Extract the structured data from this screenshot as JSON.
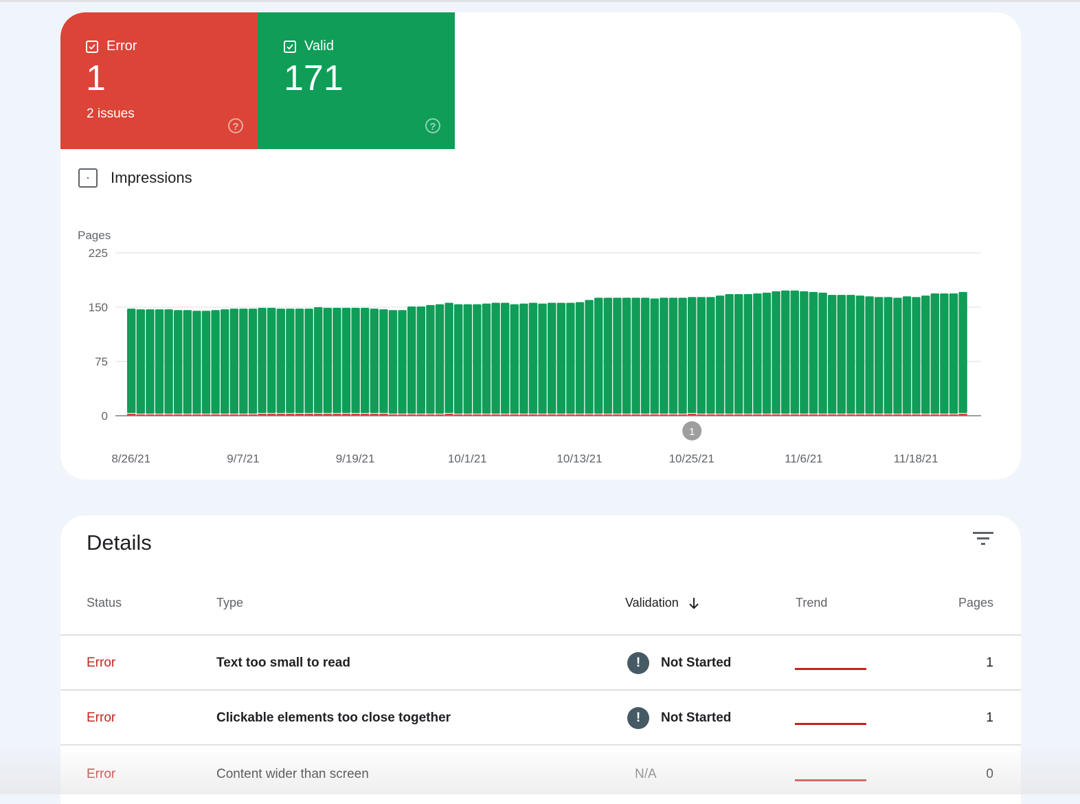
{
  "summary": {
    "error": {
      "label": "Error",
      "count": "1",
      "sub": "2 issues",
      "checked": true,
      "color": "#db4437"
    },
    "valid": {
      "label": "Valid",
      "count": "171",
      "checked": true,
      "color": "#0f9d58"
    }
  },
  "impressions": {
    "label": "Impressions",
    "checked": false
  },
  "chart_data": {
    "type": "bar",
    "stacked": true,
    "ylabel": "Pages",
    "ylim": [
      0,
      225
    ],
    "yticks": [
      0,
      75,
      150,
      225
    ],
    "grid": true,
    "xtick_labels": [
      "8/26/21",
      "9/7/21",
      "9/19/21",
      "10/1/21",
      "10/13/21",
      "10/25/21",
      "11/6/21",
      "11/18/21"
    ],
    "start_date": "8/26/21",
    "days": 90,
    "series": [
      {
        "name": "Error",
        "color": "#db4437",
        "values": [
          1,
          0,
          0,
          0,
          0,
          0,
          0,
          0,
          0,
          0,
          0,
          0,
          0,
          0,
          1,
          1,
          1,
          1,
          1,
          1,
          1,
          1,
          1,
          1,
          1,
          1,
          1,
          1,
          0,
          0,
          0,
          0,
          0,
          0,
          1,
          0,
          0,
          0,
          0,
          0,
          0,
          0,
          0,
          0,
          0,
          0,
          0,
          0,
          0,
          0,
          0,
          0,
          0,
          0,
          0,
          0,
          0,
          0,
          0,
          0,
          1,
          0,
          0,
          0,
          0,
          0,
          0,
          0,
          0,
          0,
          0,
          0,
          0,
          0,
          0,
          0,
          0,
          0,
          0,
          0,
          0,
          0,
          0,
          0,
          0,
          0,
          0,
          0,
          0,
          1
        ]
      },
      {
        "name": "Valid",
        "color": "#0f9d58",
        "values": [
          147,
          147,
          147,
          147,
          147,
          146,
          146,
          145,
          145,
          146,
          147,
          148,
          148,
          148,
          148,
          148,
          147,
          147,
          147,
          147,
          149,
          148,
          148,
          148,
          148,
          148,
          147,
          146,
          146,
          146,
          151,
          151,
          153,
          154,
          155,
          154,
          154,
          154,
          155,
          156,
          156,
          154,
          155,
          156,
          155,
          156,
          156,
          156,
          157,
          160,
          163,
          163,
          163,
          163,
          163,
          163,
          162,
          163,
          163,
          163,
          163,
          164,
          164,
          166,
          168,
          168,
          168,
          169,
          170,
          172,
          173,
          173,
          172,
          171,
          170,
          167,
          167,
          167,
          166,
          165,
          164,
          164,
          163,
          165,
          164,
          166,
          169,
          169,
          169,
          170
        ]
      }
    ],
    "annotations": [
      {
        "date": "10/25/21",
        "label": "1"
      }
    ]
  },
  "details": {
    "title": "Details",
    "columns": [
      "Status",
      "Type",
      "Validation",
      "Trend",
      "Pages"
    ],
    "sorted_column": "Validation",
    "rows": [
      {
        "status": "Error",
        "type": "Text too small to read",
        "validation": "Not Started",
        "validation_icon": "exclamation-icon",
        "pages": "1"
      },
      {
        "status": "Error",
        "type": "Clickable elements too close together",
        "validation": "Not Started",
        "validation_icon": "exclamation-icon",
        "pages": "1"
      },
      {
        "status": "Error",
        "type": "Content wider than screen",
        "validation": "N/A",
        "pages": "0"
      }
    ]
  }
}
